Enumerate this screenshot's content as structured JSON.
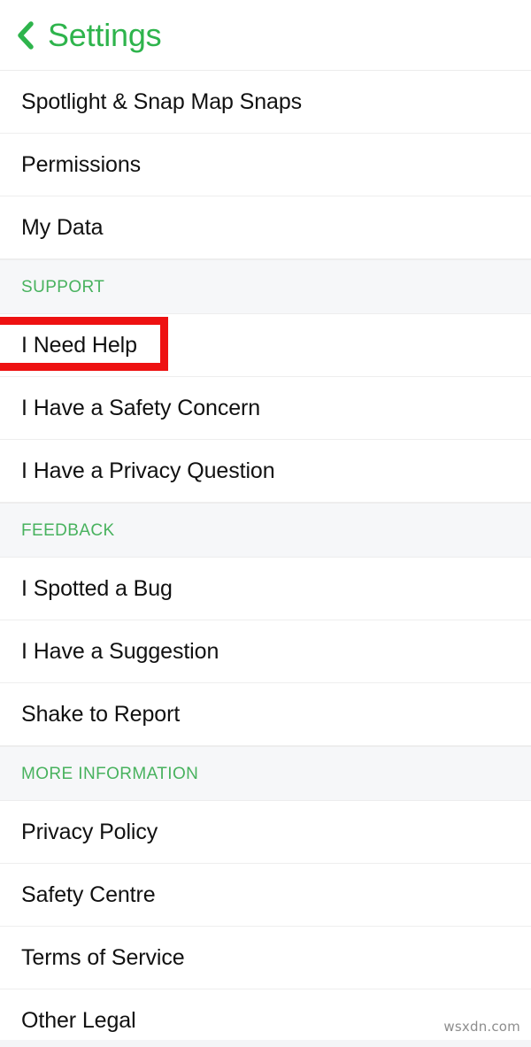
{
  "header": {
    "title": "Settings",
    "back_icon": "chevron-left-icon",
    "accent_color": "#2eb44c"
  },
  "colors": {
    "accent_green": "#2eb44c",
    "section_green": "#48b25e",
    "highlight_red": "#ee1111",
    "section_band": "#f6f7f9",
    "row_text": "#111111",
    "divider": "#eeeeee"
  },
  "list": [
    {
      "type": "row",
      "label": "Spotlight & Snap Map Snaps",
      "name": "row-spotlight-snap-map-snaps",
      "highlighted": false
    },
    {
      "type": "row",
      "label": "Permissions",
      "name": "row-permissions",
      "highlighted": false
    },
    {
      "type": "row",
      "label": "My Data",
      "name": "row-my-data",
      "highlighted": false
    },
    {
      "type": "section",
      "label": "SUPPORT",
      "name": "section-header-support"
    },
    {
      "type": "row",
      "label": "I Need Help",
      "name": "row-i-need-help",
      "highlighted": true
    },
    {
      "type": "row",
      "label": "I Have a Safety Concern",
      "name": "row-i-have-a-safety-concern",
      "highlighted": false
    },
    {
      "type": "row",
      "label": "I Have a Privacy Question",
      "name": "row-i-have-a-privacy-question",
      "highlighted": false
    },
    {
      "type": "section",
      "label": "FEEDBACK",
      "name": "section-header-feedback"
    },
    {
      "type": "row",
      "label": "I Spotted a Bug",
      "name": "row-i-spotted-a-bug",
      "highlighted": false
    },
    {
      "type": "row",
      "label": "I Have a Suggestion",
      "name": "row-i-have-a-suggestion",
      "highlighted": false
    },
    {
      "type": "row",
      "label": "Shake to Report",
      "name": "row-shake-to-report",
      "highlighted": false
    },
    {
      "type": "section",
      "label": "MORE INFORMATION",
      "name": "section-header-more-information"
    },
    {
      "type": "row",
      "label": "Privacy Policy",
      "name": "row-privacy-policy",
      "highlighted": false
    },
    {
      "type": "row",
      "label": "Safety Centre",
      "name": "row-safety-centre",
      "highlighted": false
    },
    {
      "type": "row",
      "label": "Terms of Service",
      "name": "row-terms-of-service",
      "highlighted": false
    },
    {
      "type": "row",
      "label": "Other Legal",
      "name": "row-other-legal",
      "highlighted": false
    }
  ],
  "watermark": {
    "text": "wsxdn.com"
  }
}
